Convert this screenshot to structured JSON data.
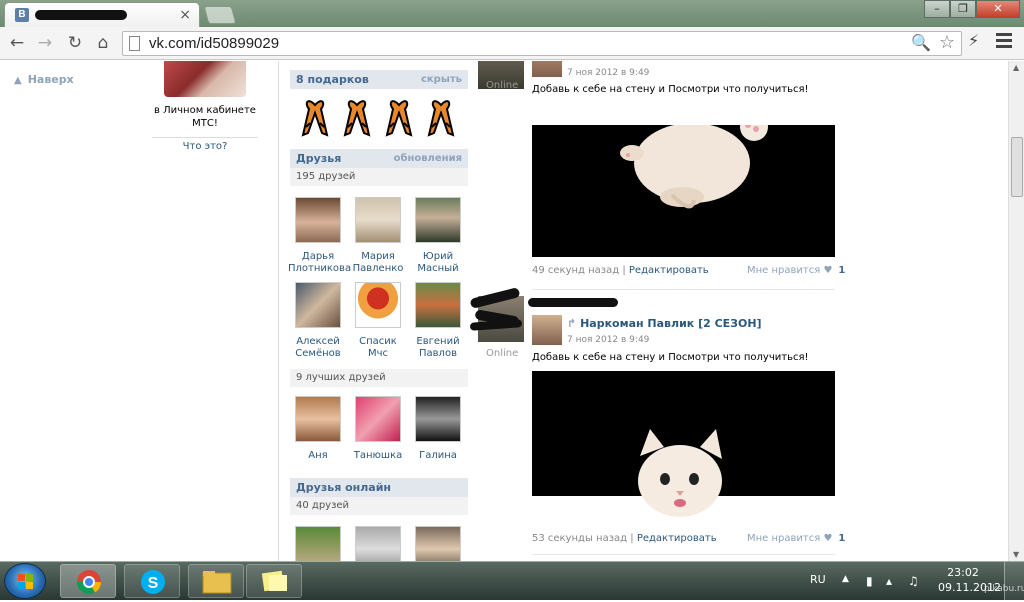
{
  "browser": {
    "tab_title": "",
    "tab_favicon_letter": "В",
    "tab_close": "×",
    "url": "vk.com/id50899029",
    "window_buttons": [
      "–",
      "❐",
      "✕"
    ]
  },
  "left_nav": {
    "to_top": "Наверх"
  },
  "ad": {
    "text": "в Личном кабинете МТС!",
    "link": "Что это?"
  },
  "gifts": {
    "title": "8 подарков",
    "action": "скрыть",
    "count_shown": 4
  },
  "friends": {
    "title": "Друзья",
    "action": "обновления",
    "count": "195 друзей",
    "items": [
      {
        "name": "Дарья Плотникова"
      },
      {
        "name": "Мария Павленко"
      },
      {
        "name": "Юрий Масный"
      },
      {
        "name": "Алексей Семёнов"
      },
      {
        "name": "Спасик Мчс"
      },
      {
        "name": "Евгений Павлов"
      }
    ]
  },
  "best_friends": {
    "title": "9 лучших друзей",
    "items": [
      {
        "name": "Аня"
      },
      {
        "name": "Танюшка"
      },
      {
        "name": "Галина"
      }
    ]
  },
  "friends_online": {
    "title": "Друзья онлайн",
    "count": "40 друзей"
  },
  "posts": [
    {
      "date": "7 ноя 2012 в 9:49",
      "online": "Online",
      "text": "Добавь к себе на стену и Посмотри что получиться!",
      "time_ago": "49 секунд назад",
      "edit": "Редактировать",
      "like_label": "Мне нравится",
      "like_count": "1"
    },
    {
      "author": "Наркоман Павлик [2 СЕЗОН]",
      "date": "7 ноя 2012 в 9:49",
      "online": "Online",
      "text": "Добавь к себе на стену и Посмотри что получиться!",
      "time_ago": "53 секунды назад",
      "edit": "Редактировать",
      "like_label": "Мне нравится",
      "like_count": "1"
    }
  ],
  "taskbar": {
    "lang": "RU",
    "time": "23:02",
    "date": "09.11.2012",
    "watermark": "pikabu.ru"
  },
  "colors": {
    "vk_link": "#2b587a",
    "vk_header_bg": "#e1e7ed",
    "vk_muted": "#8fa3ba"
  }
}
